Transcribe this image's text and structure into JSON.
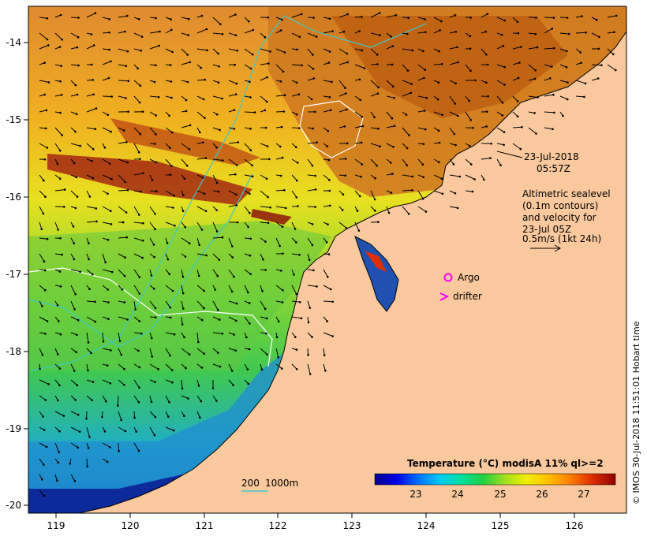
{
  "map": {
    "lon_ticks": [
      "119",
      "120",
      "121",
      "122",
      "123",
      "124",
      "125",
      "126"
    ],
    "lat_ticks": [
      "-14",
      "-15",
      "-16",
      "-17",
      "-18",
      "-19",
      "-20"
    ],
    "colors": {
      "land": "#f9c89c",
      "coast_outline": "#000000",
      "contour_white": "#ffffff",
      "contour_cyan": "#40c8c8",
      "argo": "#ff00ff",
      "drifter": "#ff00ff"
    }
  },
  "annotations": {
    "date_line1": "23-Jul-2018",
    "date_line2": "05:57Z",
    "legend_lines": [
      "Altimetric sealevel",
      "(0.1m contours)",
      "and velocity for",
      "23-Jul 05Z",
      "0.5m/s (1kt 24h)"
    ],
    "argo_label": "Argo",
    "drifter_label": "drifter",
    "depth_label_200": "200",
    "depth_label_1000": "1000m",
    "copyright": "© IMOS 30-Jul-2018 11:51:01 Hobart time"
  },
  "colorbar": {
    "title": "Temperature (°C) modisA 11% ql>=2",
    "ticks": [
      "23",
      "24",
      "25",
      "26",
      "27"
    ],
    "stops": [
      "#00008c",
      "#0000e6",
      "#0070ff",
      "#00c8f0",
      "#00e0a0",
      "#20d040",
      "#a0e020",
      "#f0f000",
      "#ffc000",
      "#ff8000",
      "#e03000",
      "#900000"
    ]
  }
}
